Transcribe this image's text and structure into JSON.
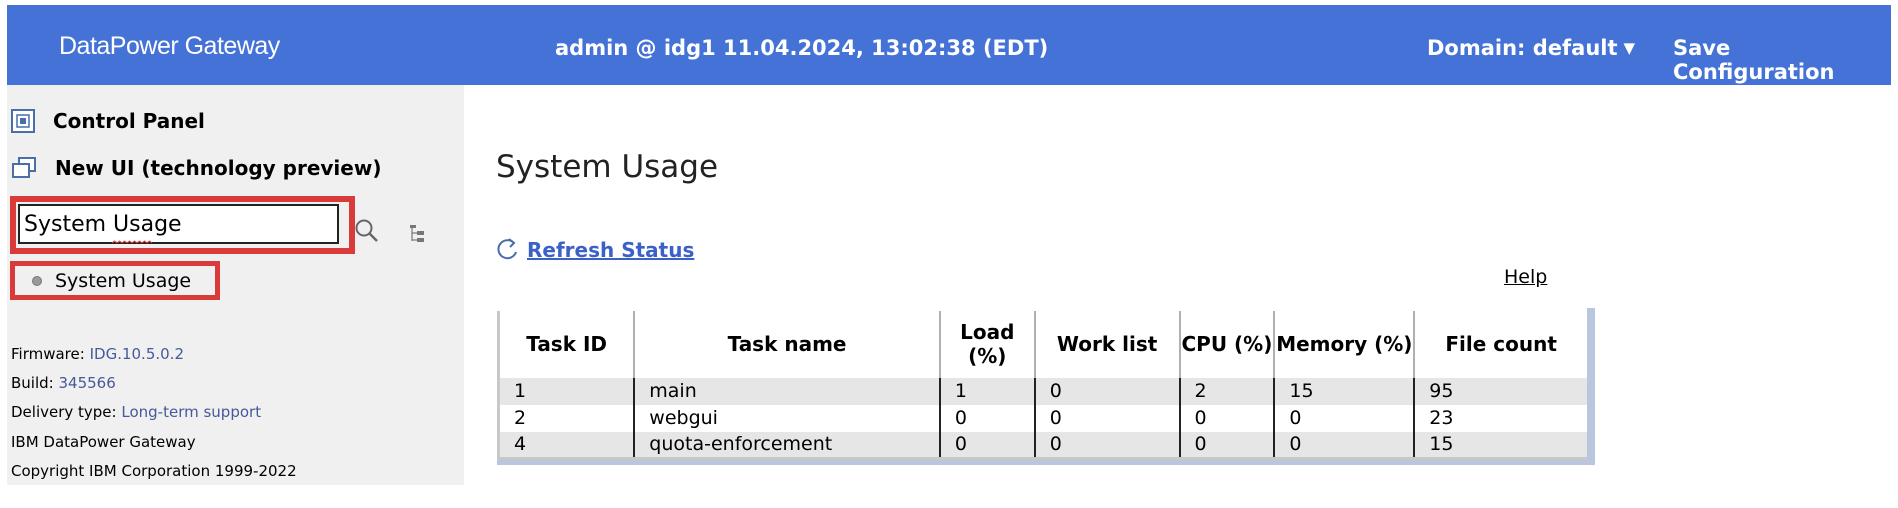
{
  "header": {
    "brand": "DataPower Gateway",
    "session": "admin @ idg1 11.04.2024, 13:02:38 (EDT)",
    "domain": "Domain: default",
    "save": "Save Configuration"
  },
  "sidebar": {
    "control_panel": "Control Panel",
    "new_ui": "New UI (technology preview)",
    "search_value": "System Usage",
    "result": "System Usage",
    "info": {
      "firmware_label": "Firmware:",
      "firmware": "IDG.10.5.0.2",
      "build_label": "Build:",
      "build": "345566",
      "delivery_label": "Delivery type:",
      "delivery": "Long-term support",
      "product": "IBM DataPower Gateway",
      "copyright": "Copyright IBM Corporation 1999-2022"
    }
  },
  "main": {
    "title": "System Usage",
    "refresh": "Refresh Status",
    "help": "Help"
  },
  "table": {
    "columns": [
      "Task ID",
      "Task name",
      "Load (%)",
      "Work list",
      "CPU (%)",
      "Memory (%)",
      "File count"
    ],
    "rows": [
      [
        "1",
        "main",
        "1",
        "0",
        "2",
        "15",
        "95"
      ],
      [
        "2",
        "webgui",
        "0",
        "0",
        "0",
        "0",
        "23"
      ],
      [
        "4",
        "quota-enforcement",
        "0",
        "0",
        "0",
        "0",
        "15"
      ]
    ]
  },
  "colors": {
    "header_bg": "#4472d6",
    "sidebar_bg": "#f0f0f0",
    "highlight": "#d93a3a",
    "link": "#3b61c8"
  }
}
